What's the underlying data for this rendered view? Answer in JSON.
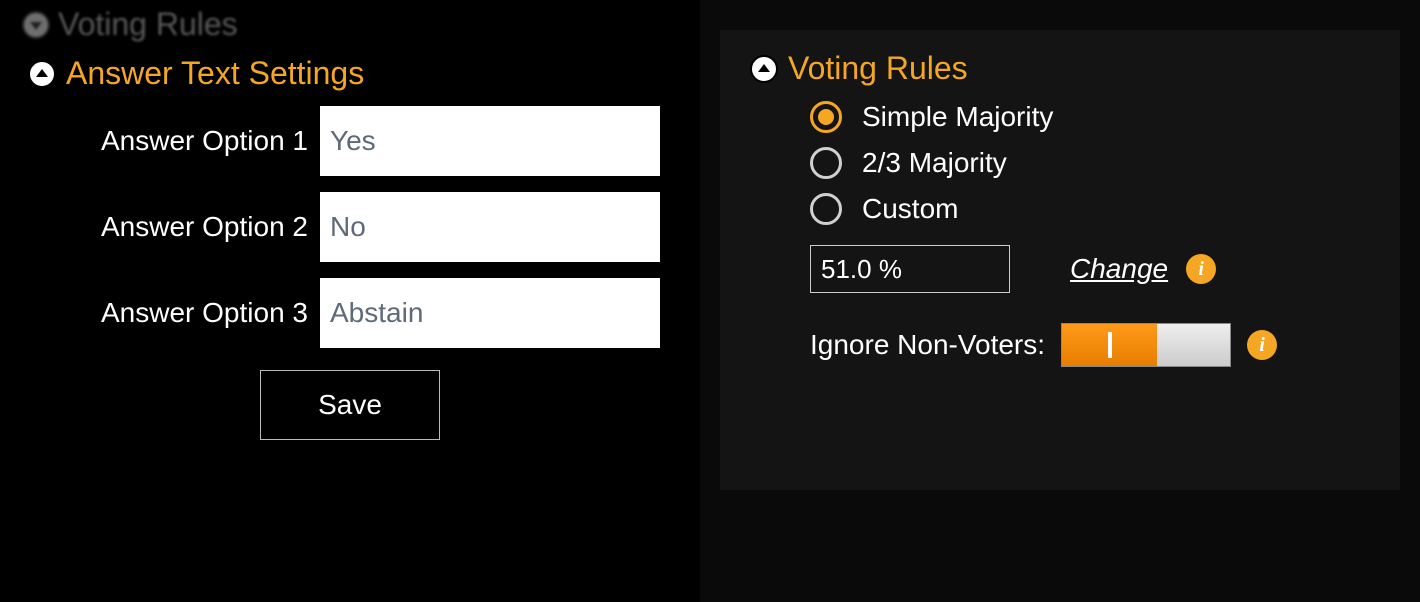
{
  "left": {
    "collapsed_section_title": "Voting Rules",
    "section_title": "Answer Text Settings",
    "options": [
      {
        "label": "Answer Option 1",
        "value": "Yes"
      },
      {
        "label": "Answer Option 2",
        "value": "No"
      },
      {
        "label": "Answer Option 3",
        "value": "Abstain"
      }
    ],
    "save_label": "Save"
  },
  "right": {
    "section_title": "Voting Rules",
    "radios": [
      {
        "label": "Simple Majority",
        "selected": true
      },
      {
        "label": "2/3 Majority",
        "selected": false
      },
      {
        "label": "Custom",
        "selected": false
      }
    ],
    "percent_value": "51.0 %",
    "change_label": "Change",
    "ignore_label": "Ignore Non-Voters:",
    "toggle_on": true
  },
  "colors": {
    "accent": "#f5a623"
  }
}
